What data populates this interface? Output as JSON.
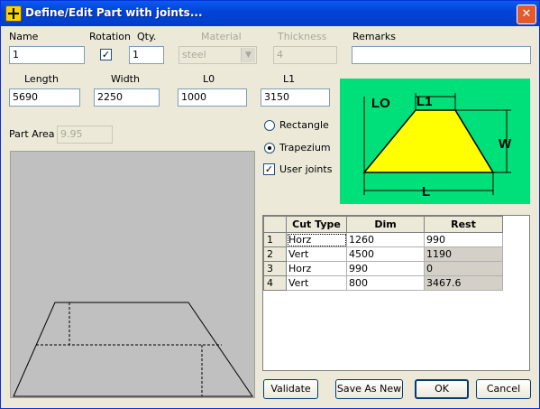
{
  "window": {
    "title": "Define/Edit Part with joints..."
  },
  "labels": {
    "name": "Name",
    "rotation": "Rotation",
    "qty": "Qty.",
    "material": "Material",
    "thickness": "Thickness",
    "remarks": "Remarks",
    "length": "Length",
    "width": "Width",
    "l0": "L0",
    "l1": "L1",
    "part_area": "Part Area"
  },
  "fields": {
    "name": "1",
    "rotation_checked": true,
    "qty": "1",
    "material": "steel",
    "thickness": "4",
    "remarks": "",
    "length": "5690",
    "width": "2250",
    "l0": "1000",
    "l1": "3150",
    "part_area": "9.95"
  },
  "options": {
    "rectangle": "Rectangle",
    "trapezium": "Trapezium",
    "user_joints": "User joints",
    "selected": "trapezium",
    "user_joints_checked": true
  },
  "diagram": {
    "lo": "LO",
    "l1": "L1",
    "w": "W",
    "l": "L",
    "bg_color": "#00e07a",
    "fill_color": "#ffff00"
  },
  "grid": {
    "headers": [
      "Cut Type",
      "Dim",
      "Rest"
    ],
    "rows": [
      {
        "n": "1",
        "cut": "Horz",
        "dim": "1260",
        "rest": "990"
      },
      {
        "n": "2",
        "cut": "Vert",
        "dim": "4500",
        "rest": "1190"
      },
      {
        "n": "3",
        "cut": "Horz",
        "dim": "990",
        "rest": "0"
      },
      {
        "n": "4",
        "cut": "Vert",
        "dim": "800",
        "rest": "3467.6"
      }
    ]
  },
  "buttons": {
    "validate": "Validate",
    "save_as_new": "Save As New",
    "ok": "OK",
    "cancel": "Cancel"
  }
}
